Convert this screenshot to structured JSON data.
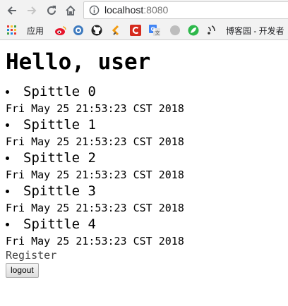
{
  "browser": {
    "url_host": "localhost",
    "url_port": ":8080",
    "bookmarks": [
      {
        "icon": "apps-grid-icon",
        "label": "应用"
      },
      {
        "icon": "weibo-icon",
        "label": ""
      },
      {
        "icon": "globe-icon",
        "label": ""
      },
      {
        "icon": "github-icon",
        "label": ""
      },
      {
        "icon": "bookmark-arrow-icon",
        "label": ""
      },
      {
        "icon": "red-c-icon",
        "label": ""
      },
      {
        "icon": "translate-icon",
        "label": ""
      },
      {
        "icon": "grey-circle-icon",
        "label": ""
      },
      {
        "icon": "green-leaf-icon",
        "label": ""
      },
      {
        "icon": "cnblogs-icon",
        "label": "博客园 - 开发者"
      }
    ],
    "colors": {
      "chrome_bg": "#f2f2f2",
      "weibo_red": "#e6162d",
      "c_red": "#d52b1e",
      "leaf_green": "#2db84b"
    }
  },
  "page": {
    "title": "Hello, user",
    "spittles": [
      {
        "message": "Spittle 0",
        "time": "Fri May 25 21:53:23 CST 2018"
      },
      {
        "message": "Spittle 1",
        "time": "Fri May 25 21:53:23 CST 2018"
      },
      {
        "message": "Spittle 2",
        "time": "Fri May 25 21:53:23 CST 2018"
      },
      {
        "message": "Spittle 3",
        "time": "Fri May 25 21:53:23 CST 2018"
      },
      {
        "message": "Spittle 4",
        "time": "Fri May 25 21:53:23 CST 2018"
      }
    ],
    "register_label": "Register",
    "logout_label": "logout"
  }
}
